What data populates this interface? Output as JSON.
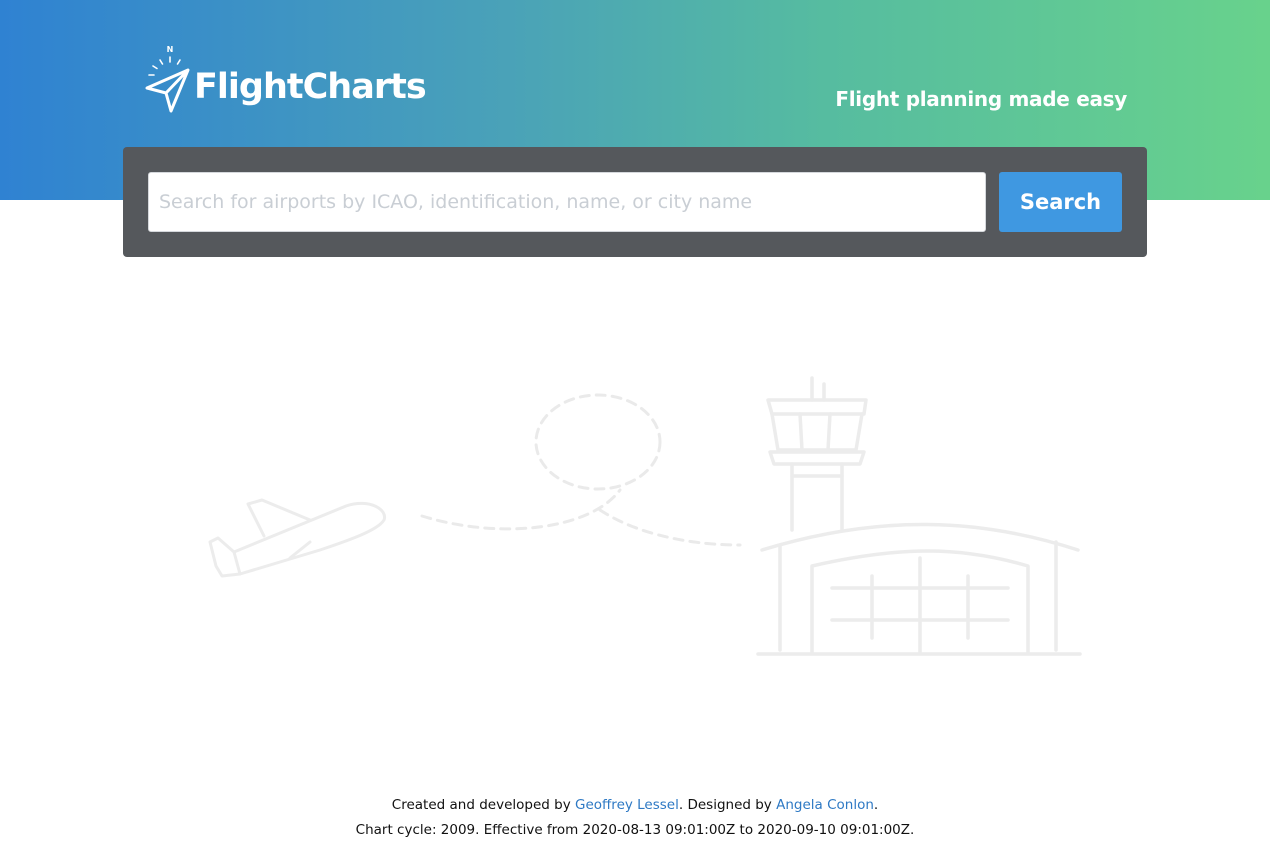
{
  "brand": {
    "logo_text": "FlightCharts",
    "compass_letter": "N",
    "tagline": "Flight planning made easy",
    "gradient_start": "#2f82d2",
    "gradient_end": "#68d28c"
  },
  "search": {
    "placeholder": "Search for airports by ICAO, identification, name, or city name",
    "value": "",
    "button_label": "Search",
    "panel_color": "#55585c",
    "button_color": "#3f98e1"
  },
  "illustration": {
    "icons": [
      "airplane-icon",
      "flight-path-icon",
      "control-tower-icon",
      "terminal-icon"
    ]
  },
  "footer": {
    "credits_prefix": "Created and developed by ",
    "developer_name": "Geoffrey Lessel",
    "designed_by_text": ". Designed by ",
    "designer_name": "Angela Conlon",
    "credits_suffix": ".",
    "chart_cycle_text": "Chart cycle: 2009. Effective from 2020-08-13 09:01:00Z to 2020-09-10 09:01:00Z.",
    "link_color": "#2e79c4"
  }
}
